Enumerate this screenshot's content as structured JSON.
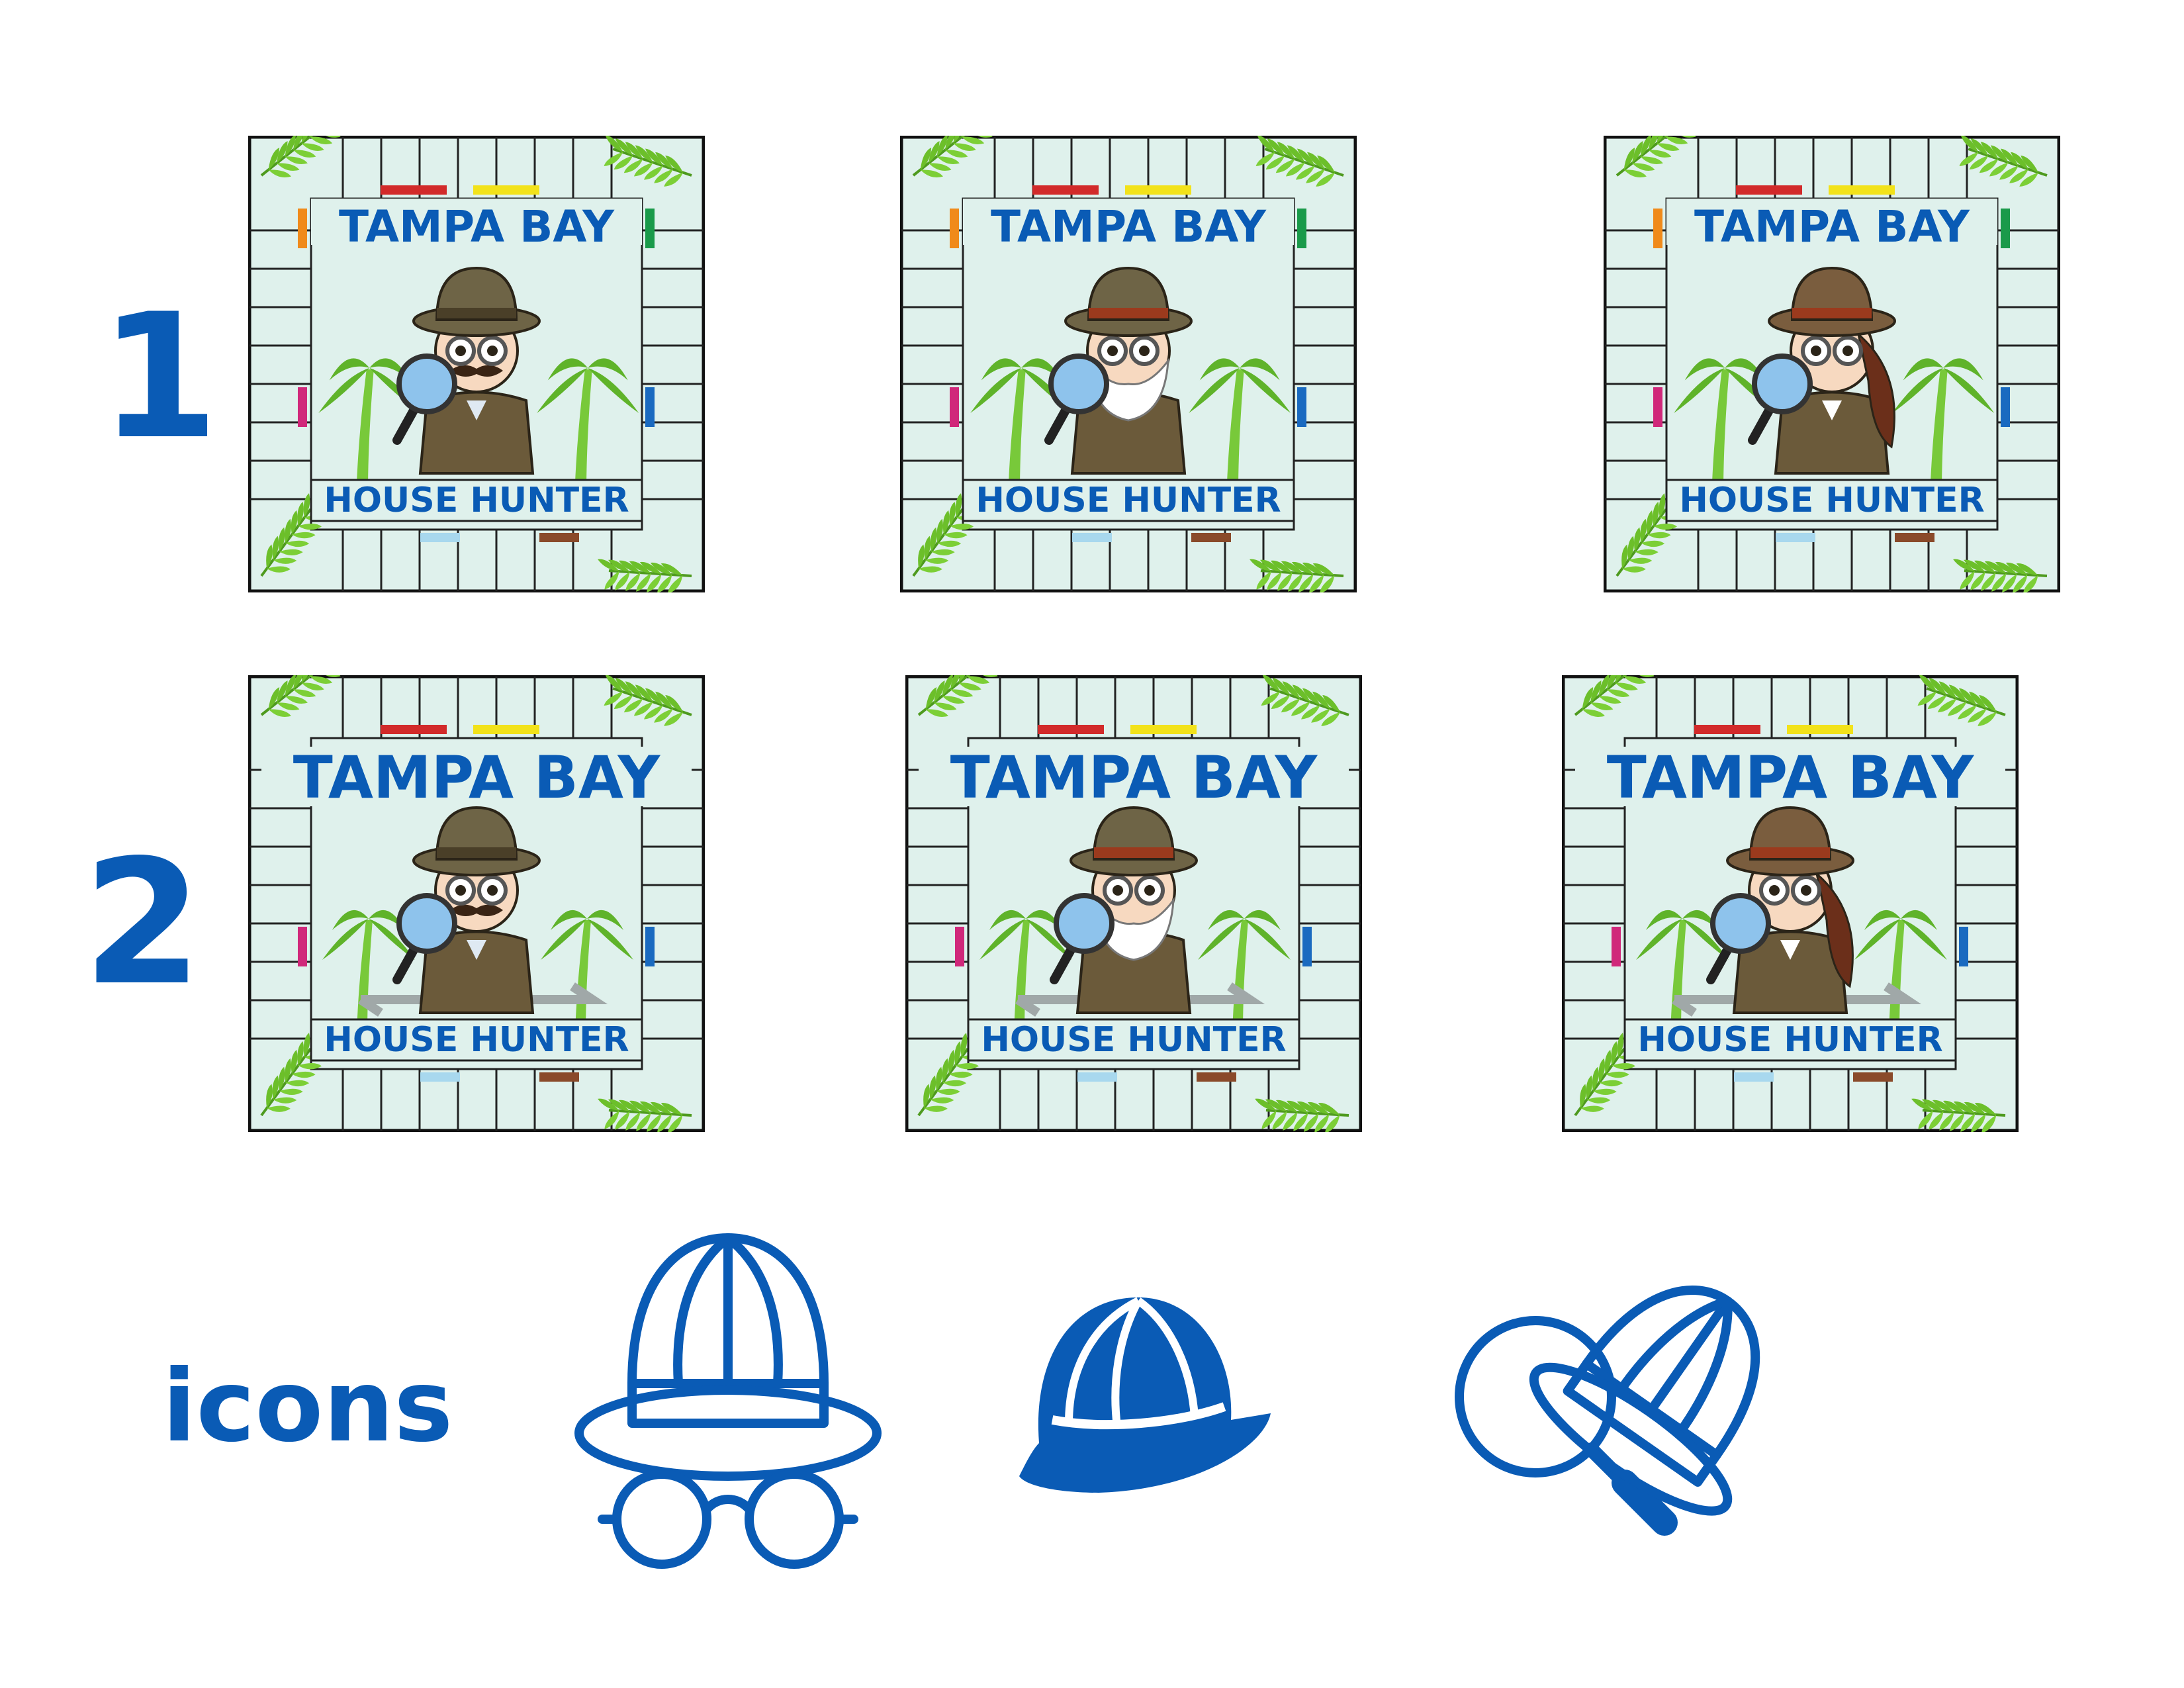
{
  "row_labels": [
    "1",
    "2",
    "icons"
  ],
  "tiles": [
    {
      "title": "TAMPA BAY",
      "subtitle": "HOUSE HUNTER",
      "character": "explorer-man-mustache",
      "variant": 1
    },
    {
      "title": "TAMPA BAY",
      "subtitle": "HOUSE HUNTER",
      "character": "explorer-old-man-beard",
      "variant": 1
    },
    {
      "title": "TAMPA BAY",
      "subtitle": "HOUSE HUNTER",
      "character": "explorer-woman",
      "variant": 1
    },
    {
      "title": "TAMPA BAY",
      "subtitle": "HOUSE HUNTER",
      "character": "explorer-man-mustache",
      "variant": 2
    },
    {
      "title": "TAMPA BAY",
      "subtitle": "HOUSE HUNTER",
      "character": "explorer-old-man-beard",
      "variant": 2
    },
    {
      "title": "TAMPA BAY",
      "subtitle": "HOUSE HUNTER",
      "character": "explorer-woman",
      "variant": 2
    }
  ],
  "icons": [
    "safari-hat-glasses-outline-icon",
    "safari-hat-solid-icon",
    "magnifier-safari-hat-outline-icon"
  ],
  "colors": {
    "brand_blue": "#0a5bb5",
    "board_bg": "#dff1ec",
    "palm_green": "#6cbf2a",
    "hat_brown": "#6b5a3a"
  }
}
